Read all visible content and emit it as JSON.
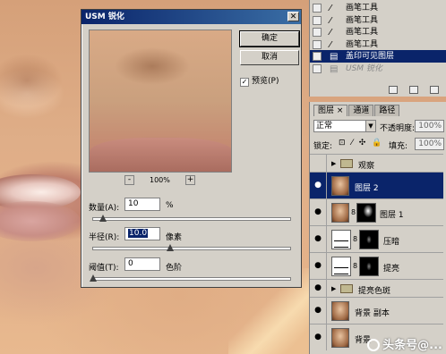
{
  "dialog": {
    "title": "USM 锐化",
    "close_glyph": "✕",
    "ok_label": "确定",
    "cancel_label": "取消",
    "preview_label": "预览(P)",
    "preview_checked": true,
    "zoom_out": "-",
    "zoom_in": "+",
    "zoom_level": "100%",
    "amount_label": "数量(A):",
    "amount_value": "10",
    "amount_unit": "%",
    "amount_slider": 0.05,
    "radius_label": "半径(R):",
    "radius_value": "10.0",
    "radius_unit": "像素",
    "radius_slider": 0.4,
    "threshold_label": "阈值(T):",
    "threshold_value": "0",
    "threshold_unit": "色阶",
    "threshold_slider": 0.0
  },
  "history": {
    "items": [
      {
        "icon": "brush-icon",
        "label": "画笔工具",
        "state": "normal"
      },
      {
        "icon": "brush-icon",
        "label": "画笔工具",
        "state": "normal"
      },
      {
        "icon": "brush-icon",
        "label": "画笔工具",
        "state": "normal"
      },
      {
        "icon": "brush-icon",
        "label": "画笔工具",
        "state": "normal"
      },
      {
        "icon": "layer-icon",
        "label": "盖印可见图层",
        "state": "active"
      },
      {
        "icon": "layer-icon",
        "label": "USM 锐化",
        "state": "dim"
      }
    ]
  },
  "layers": {
    "tabs": [
      "图层 ×",
      "通道",
      "路径"
    ],
    "blend_mode": "正常",
    "opacity_label": "不透明度:",
    "opacity_value": "100%",
    "lock_label": "锁定:",
    "lock_icons": "⊡ ⁄ ✣ 🔒",
    "fill_label": "填充:",
    "fill_value": "100%",
    "items": [
      {
        "name": "观察",
        "type": "group",
        "visible": false
      },
      {
        "name": "图层 2",
        "type": "pixel",
        "visible": true,
        "selected": true
      },
      {
        "name": "图层 1",
        "type": "masked",
        "visible": true
      },
      {
        "name": "压暗",
        "type": "adjust-dark",
        "visible": true
      },
      {
        "name": "提亮",
        "type": "adjust-light",
        "visible": true
      },
      {
        "name": "提亮色斑",
        "type": "group",
        "visible": true
      },
      {
        "name": "背景 副本",
        "type": "pixel",
        "visible": true
      },
      {
        "name": "背景",
        "type": "pixel",
        "visible": true
      }
    ]
  },
  "watermark": "头条号@..."
}
